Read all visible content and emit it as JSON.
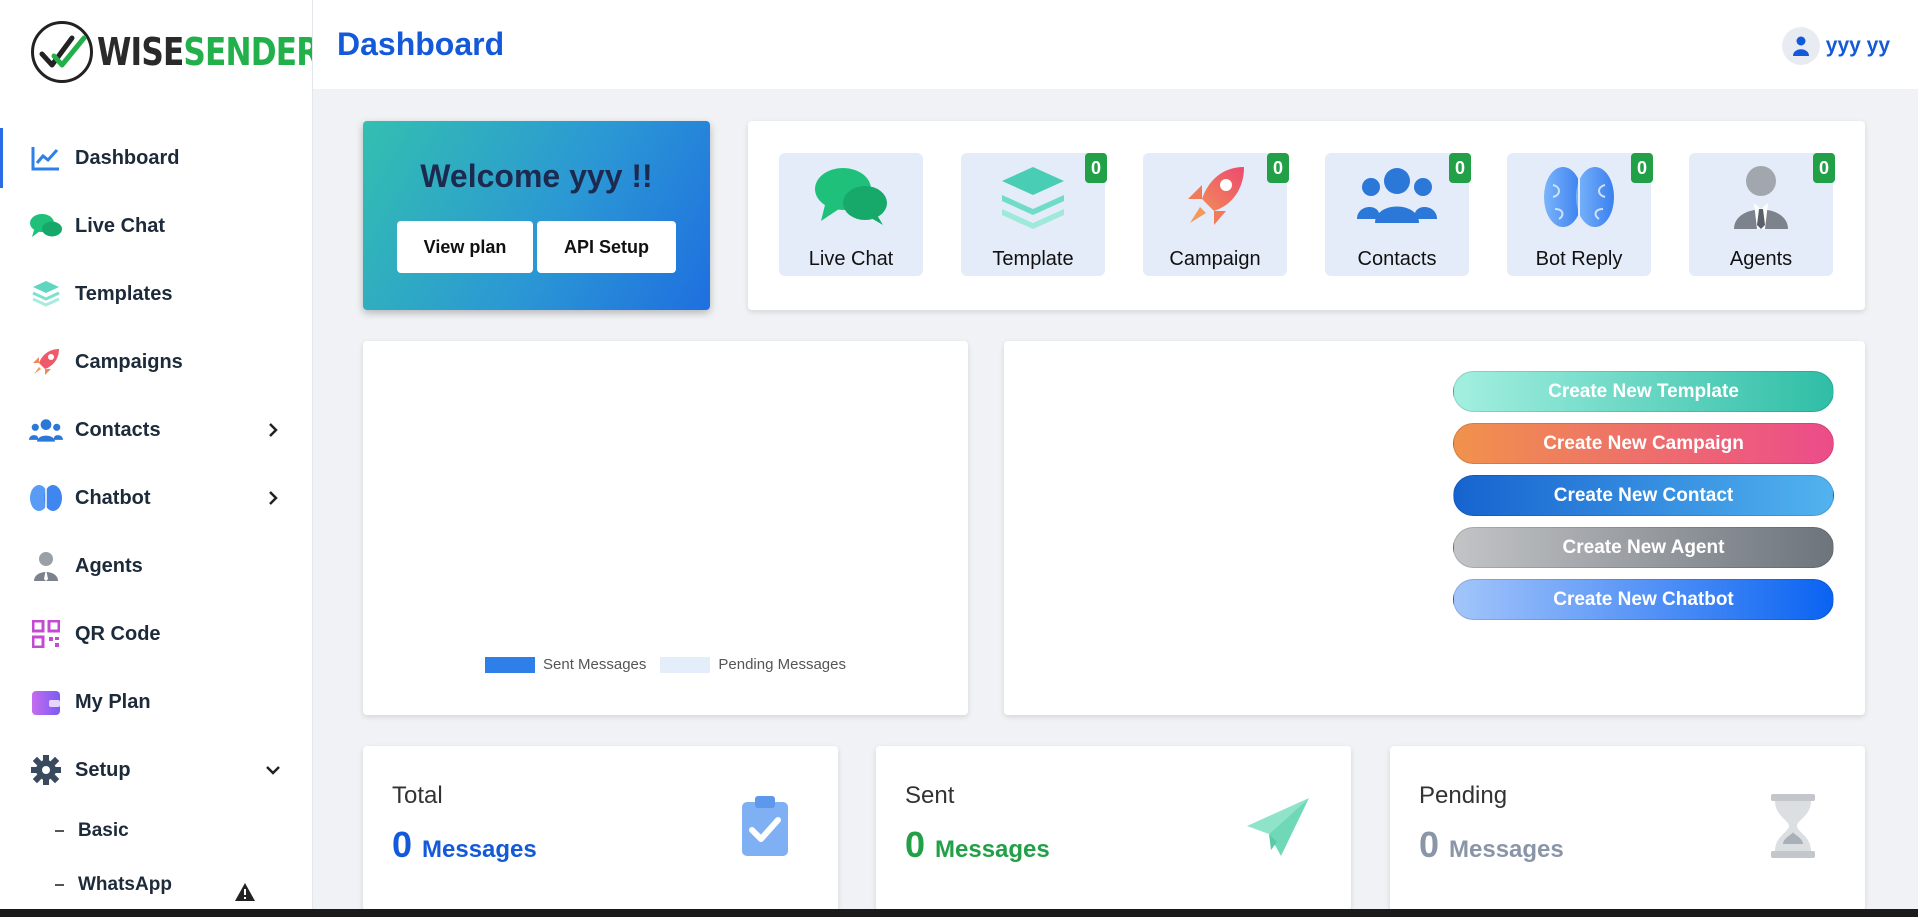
{
  "brand": {
    "name_part1": "WISE",
    "name_part2": "SENDER"
  },
  "header": {
    "title": "Dashboard",
    "user_name": "yyy yy"
  },
  "sidebar": {
    "items": [
      {
        "label": "Dashboard",
        "icon": "chart-line-icon"
      },
      {
        "label": "Live Chat",
        "icon": "chat-bubbles-icon"
      },
      {
        "label": "Templates",
        "icon": "layers-icon"
      },
      {
        "label": "Campaigns",
        "icon": "rocket-icon"
      },
      {
        "label": "Contacts",
        "icon": "users-icon"
      },
      {
        "label": "Chatbot",
        "icon": "brain-icon"
      },
      {
        "label": "Agents",
        "icon": "agent-icon"
      },
      {
        "label": "QR Code",
        "icon": "qr-code-icon"
      },
      {
        "label": "My Plan",
        "icon": "wallet-icon"
      },
      {
        "label": "Setup",
        "icon": "gear-icon"
      }
    ],
    "setup_sub": [
      {
        "label": "Basic"
      },
      {
        "label": "WhatsApp"
      }
    ]
  },
  "welcome": {
    "title": "Welcome yyy !!",
    "view_plan": "View plan",
    "api_setup": "API Setup"
  },
  "tiles": [
    {
      "label": "Live Chat",
      "icon": "chat-bubbles-icon",
      "count": null
    },
    {
      "label": "Template",
      "icon": "layers-icon",
      "count": "0"
    },
    {
      "label": "Campaign",
      "icon": "rocket-icon",
      "count": "0"
    },
    {
      "label": "Contacts",
      "icon": "users-icon",
      "count": "0"
    },
    {
      "label": "Bot Reply",
      "icon": "brain-icon",
      "count": "0"
    },
    {
      "label": "Agents",
      "icon": "agent-icon",
      "count": "0"
    }
  ],
  "chart": {
    "legend": [
      {
        "label": "Sent Messages",
        "color": "#2f7fe8"
      },
      {
        "label": "Pending Messages",
        "color": "#e4eefb"
      }
    ]
  },
  "actions": [
    {
      "label": "Create New Template"
    },
    {
      "label": "Create New Campaign"
    },
    {
      "label": "Create New Contact"
    },
    {
      "label": "Create New Agent"
    },
    {
      "label": "Create New Chatbot"
    }
  ],
  "stats": [
    {
      "label": "Total",
      "value": "0",
      "unit": "Messages",
      "color": "#1459d9",
      "icon": "clipboard-check-icon"
    },
    {
      "label": "Sent",
      "value": "0",
      "unit": "Messages",
      "color": "#22a047",
      "icon": "paper-plane-icon"
    },
    {
      "label": "Pending",
      "value": "0",
      "unit": "Messages",
      "color": "#8a96a8",
      "icon": "hourglass-icon"
    }
  ],
  "colors": {
    "primary": "#1459d9",
    "success": "#22a047"
  }
}
